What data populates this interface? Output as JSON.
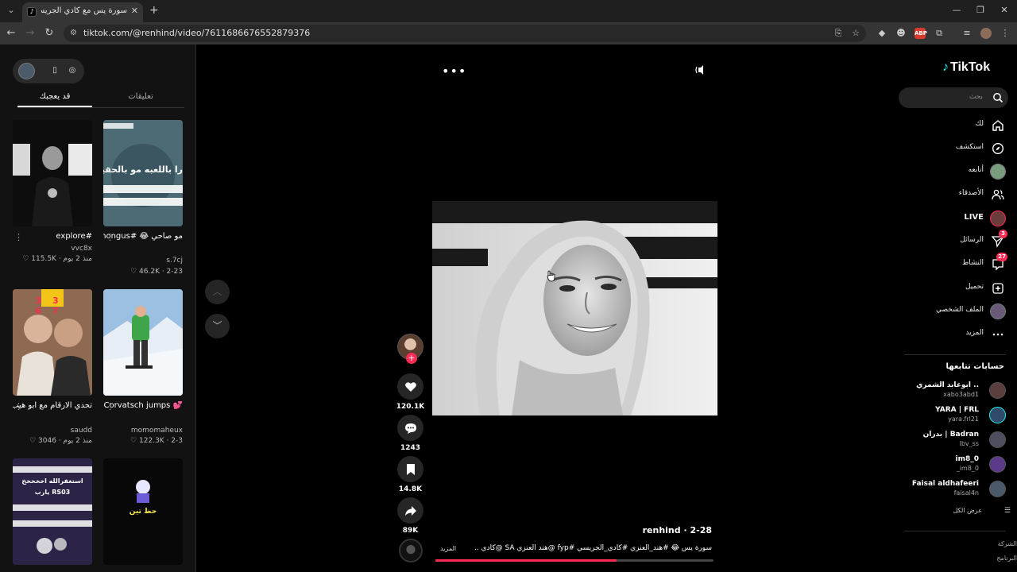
{
  "browser": {
    "tab_title": "سورة يس مع كادي الجريسي",
    "tab_favicon": "tiktok-favicon",
    "url": "tiktok.com/@renhind/video/7611686676552879376"
  },
  "left_panel": {
    "tabs": [
      "تعليقات",
      "قد يعجبك"
    ],
    "active_tab": 1,
    "items": [
      {
        "title": "#explore",
        "user": "vvc8x",
        "stats": "♡ 115.5K · منذ 2 يوم"
      },
      {
        "title": "مو صاحي 😂 #amongus #شوق...",
        "user": "s.7cj",
        "stats": "♡ 46.2K · 2-23",
        "overlay": "را باللعبه مو بالحقية"
      },
      {
        "title": "تحدي الارقام مع ابو هيب @abohaeeb #تحد...",
        "user": "saudd",
        "stats": "♡ 3046 · منذ 2 يوم",
        "overlay": "33 67"
      },
      {
        "title": "Corvatsch jumps 💕",
        "user": "momomaheux",
        "stats": "♡ 122.3K · 2-3"
      },
      {
        "title": "",
        "user": "",
        "stats": "",
        "overlay": "استغفرالله اخخخخخ RS03 يارب"
      },
      {
        "title": "",
        "user": "",
        "stats": "",
        "overlay": "حظ تين"
      }
    ]
  },
  "center": {
    "more_label": "•••",
    "creator": "renhind",
    "date": "2-28",
    "author_line": "renhind · 2-28",
    "caption": "سورة يس 😂 #هند_العنزي #كادي_الجريسي #fyp @هند العنزي SA @كادي ...",
    "more_text": "المزيد",
    "actions": {
      "likes": "120.1K",
      "comments": "1243",
      "saves": "14.8K",
      "shares": "89K"
    },
    "progress_fraction": 0.65,
    "accent_color": "#fe2c55"
  },
  "right_nav": {
    "logo": "TikTok",
    "search_placeholder": "بحث",
    "items": [
      {
        "label": "لك",
        "icon": "home-icon"
      },
      {
        "label": "استكشف",
        "icon": "compass-icon"
      },
      {
        "label": "أتابعه",
        "icon": "following-avatar"
      },
      {
        "label": "الأصدقاء",
        "icon": "friends-icon"
      },
      {
        "label": "LIVE",
        "icon": "live-avatar"
      },
      {
        "label": "الرسائل",
        "icon": "send-icon",
        "badge": "3"
      },
      {
        "label": "النشاط",
        "icon": "inbox-icon",
        "badge": "27"
      },
      {
        "label": "تحميل",
        "icon": "upload-icon"
      },
      {
        "label": "الملف الشخصي",
        "icon": "profile-avatar"
      },
      {
        "label": "المزيد",
        "icon": "more-icon"
      }
    ],
    "following_title": "حسابات تتابعها",
    "following": [
      {
        "name": "ابوعابد الشمري ..",
        "user": "xabo3abd1"
      },
      {
        "name": "YARA | FRL",
        "user": "yara.frl21"
      },
      {
        "name": "بدران | Badran",
        "user": "lbv_ss"
      },
      {
        "name": "im8_0",
        "user": "_im8_0"
      },
      {
        "name": "Faisal aldhafeeri",
        "user": "faisal4n"
      }
    ],
    "see_all": "عرض الكل",
    "footer": [
      "الشركة",
      "البرنامج"
    ]
  }
}
